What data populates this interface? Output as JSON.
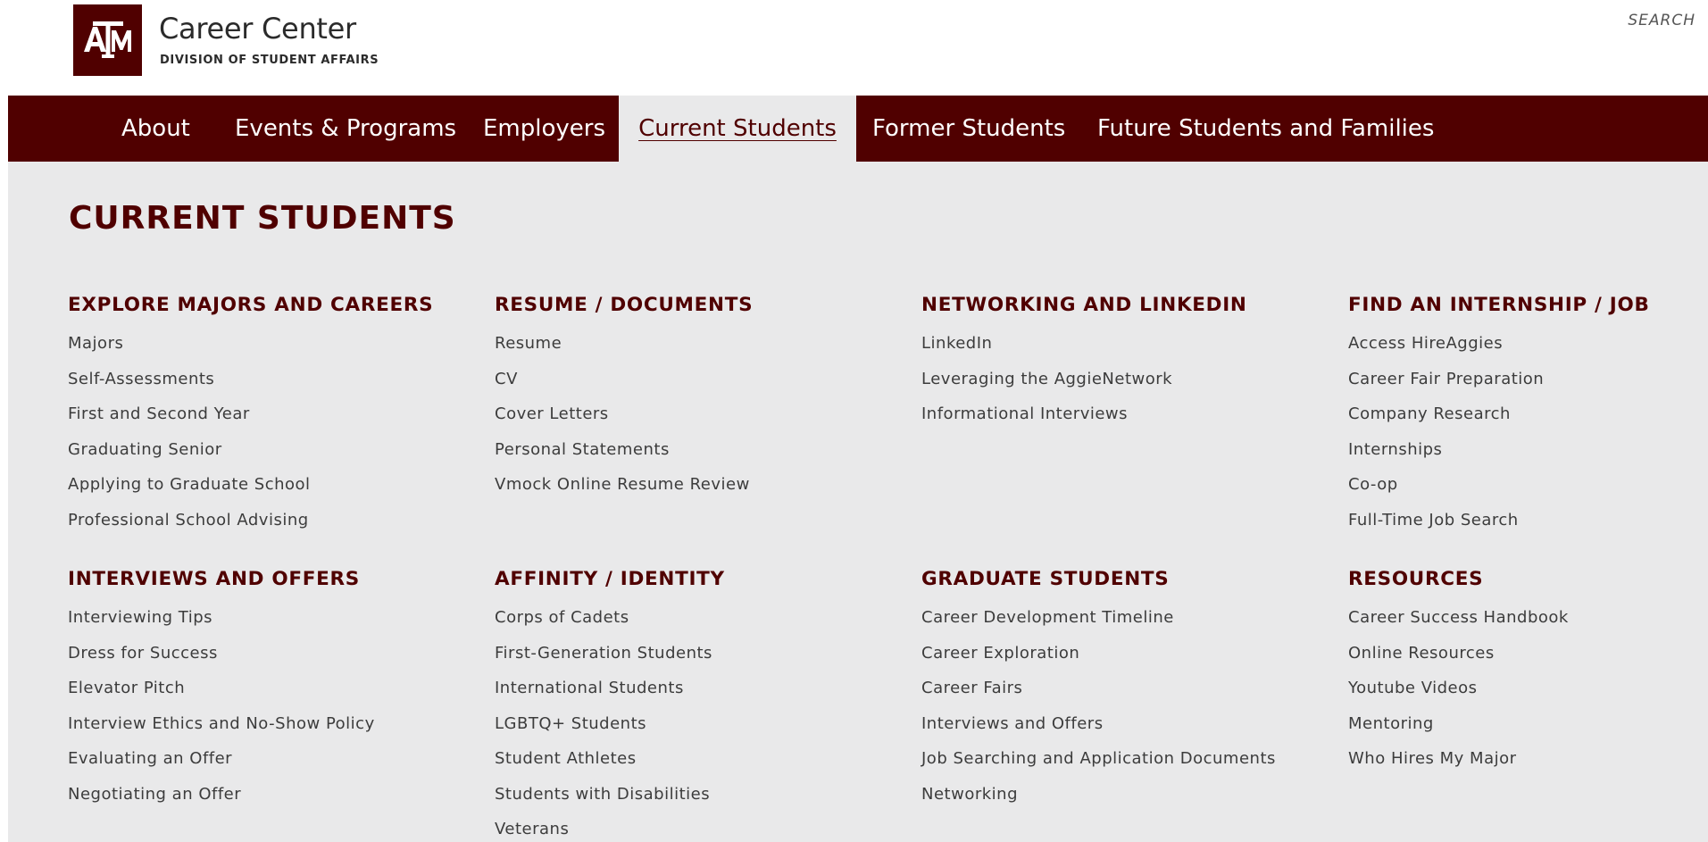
{
  "header": {
    "logo_text": "ATM",
    "title": "Career Center",
    "subtitle": "DIVISION OF STUDENT AFFAIRS",
    "search_label": "SEARCH"
  },
  "nav": {
    "items": [
      {
        "label": "About"
      },
      {
        "label": "Events & Programs"
      },
      {
        "label": "Employers"
      },
      {
        "label": "Current Students",
        "active": true
      },
      {
        "label": "Former Students"
      },
      {
        "label": "Future Students and Families"
      }
    ]
  },
  "panel": {
    "title": "CURRENT STUDENTS",
    "sections": [
      {
        "heading": "EXPLORE MAJORS AND CAREERS",
        "links": [
          "Majors",
          "Self-Assessments",
          "First and Second Year",
          "Graduating Senior",
          "Applying to Graduate School",
          "Professional School Advising"
        ]
      },
      {
        "heading": "RESUME / DOCUMENTS",
        "links": [
          "Resume",
          "CV",
          "Cover Letters",
          "Personal Statements",
          "Vmock Online Resume Review"
        ]
      },
      {
        "heading": "NETWORKING AND LINKEDIN",
        "links": [
          "LinkedIn",
          "Leveraging the AggieNetwork",
          "Informational Interviews"
        ]
      },
      {
        "heading": "FIND AN INTERNSHIP / JOB",
        "links": [
          "Access HireAggies",
          "Career Fair Preparation",
          "Company Research",
          "Internships",
          "Co-op",
          "Full-Time Job Search"
        ]
      },
      {
        "heading": "INTERVIEWS AND OFFERS",
        "links": [
          "Interviewing Tips",
          "Dress for Success",
          "Elevator Pitch",
          "Interview Ethics and No-Show Policy",
          "Evaluating an Offer",
          "Negotiating an Offer"
        ]
      },
      {
        "heading": "AFFINITY / IDENTITY",
        "links": [
          "Corps of Cadets",
          "First-Generation Students",
          "International Students",
          "LGBTQ+ Students",
          "Student Athletes",
          "Students with Disabilities",
          "Veterans"
        ]
      },
      {
        "heading": "GRADUATE STUDENTS",
        "links": [
          "Career Development Timeline",
          "Career Exploration",
          "Career Fairs",
          "Interviews and Offers",
          "Job Searching and Application Documents",
          "Networking"
        ]
      },
      {
        "heading": "RESOURCES",
        "links": [
          "Career Success Handbook",
          "Online Resources",
          "Youtube Videos",
          "Mentoring",
          "Who Hires My Major"
        ]
      }
    ]
  },
  "colors": {
    "brand_maroon": "#500000",
    "panel_bg": "#e9e9ea",
    "link_text": "#3c3c3c"
  }
}
